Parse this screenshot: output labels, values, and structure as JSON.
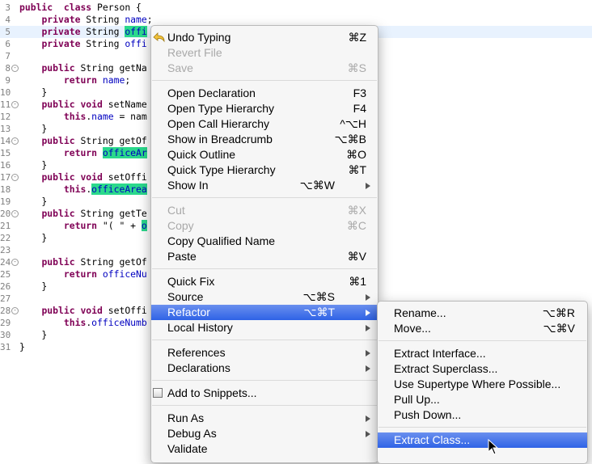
{
  "editor": {
    "lines": [
      {
        "num": "3",
        "fold": "",
        "parts": [
          [
            "kw",
            "public"
          ],
          [
            "",
            "  "
          ],
          [
            "kw",
            "class"
          ],
          [
            "",
            " Person {"
          ]
        ]
      },
      {
        "num": "4",
        "fold": "",
        "parts": [
          [
            "",
            "    "
          ],
          [
            "kw",
            "private"
          ],
          [
            "",
            " String "
          ],
          [
            "fld",
            "name"
          ],
          [
            "",
            ";"
          ]
        ]
      },
      {
        "num": "5",
        "fold": "",
        "current": true,
        "parts": [
          [
            "",
            "    "
          ],
          [
            "kw",
            "private"
          ],
          [
            "",
            " String "
          ],
          [
            "fld hl",
            "offi"
          ]
        ]
      },
      {
        "num": "6",
        "fold": "",
        "parts": [
          [
            "",
            "    "
          ],
          [
            "kw",
            "private"
          ],
          [
            "",
            " String "
          ],
          [
            "fld",
            "offi"
          ]
        ]
      },
      {
        "num": "7",
        "fold": "",
        "parts": []
      },
      {
        "num": "8",
        "fold": "-",
        "parts": [
          [
            "",
            "    "
          ],
          [
            "kw",
            "public"
          ],
          [
            "",
            " String getNa"
          ]
        ]
      },
      {
        "num": "9",
        "fold": "",
        "parts": [
          [
            "",
            "        "
          ],
          [
            "kw",
            "return"
          ],
          [
            "",
            " "
          ],
          [
            "fld",
            "name"
          ],
          [
            "",
            ";"
          ]
        ]
      },
      {
        "num": "10",
        "fold": "",
        "parts": [
          [
            "",
            "    }"
          ]
        ]
      },
      {
        "num": "11",
        "fold": "-",
        "parts": [
          [
            "",
            "    "
          ],
          [
            "kw",
            "public"
          ],
          [
            "",
            " "
          ],
          [
            "kw",
            "void"
          ],
          [
            "",
            " setName"
          ]
        ]
      },
      {
        "num": "12",
        "fold": "",
        "parts": [
          [
            "",
            "        "
          ],
          [
            "kw",
            "this"
          ],
          [
            "",
            "."
          ],
          [
            "fld",
            "name"
          ],
          [
            "",
            " = nam"
          ]
        ]
      },
      {
        "num": "13",
        "fold": "",
        "parts": [
          [
            "",
            "    }"
          ]
        ]
      },
      {
        "num": "14",
        "fold": "-",
        "parts": [
          [
            "",
            "    "
          ],
          [
            "kw",
            "public"
          ],
          [
            "",
            " String getOf"
          ]
        ]
      },
      {
        "num": "15",
        "fold": "",
        "parts": [
          [
            "",
            "        "
          ],
          [
            "kw",
            "return"
          ],
          [
            "",
            " "
          ],
          [
            "fld hl",
            "officeAr"
          ]
        ]
      },
      {
        "num": "16",
        "fold": "",
        "parts": [
          [
            "",
            "    }"
          ]
        ]
      },
      {
        "num": "17",
        "fold": "-",
        "parts": [
          [
            "",
            "    "
          ],
          [
            "kw",
            "public"
          ],
          [
            "",
            " "
          ],
          [
            "kw",
            "void"
          ],
          [
            "",
            " setOffi"
          ]
        ]
      },
      {
        "num": "18",
        "fold": "",
        "parts": [
          [
            "",
            "        "
          ],
          [
            "kw",
            "this"
          ],
          [
            "",
            "."
          ],
          [
            "fld hl",
            "officeArea"
          ]
        ]
      },
      {
        "num": "19",
        "fold": "",
        "parts": [
          [
            "",
            "    }"
          ]
        ]
      },
      {
        "num": "20",
        "fold": "-",
        "parts": [
          [
            "",
            "    "
          ],
          [
            "kw",
            "public"
          ],
          [
            "",
            " String getTe"
          ]
        ]
      },
      {
        "num": "21",
        "fold": "",
        "parts": [
          [
            "",
            "        "
          ],
          [
            "kw",
            "return"
          ],
          [
            "",
            " \"( \" + "
          ],
          [
            "fld hl",
            "o"
          ]
        ]
      },
      {
        "num": "22",
        "fold": "",
        "parts": [
          [
            "",
            "    }"
          ]
        ]
      },
      {
        "num": "23",
        "fold": "",
        "parts": []
      },
      {
        "num": "24",
        "fold": "-",
        "parts": [
          [
            "",
            "    "
          ],
          [
            "kw",
            "public"
          ],
          [
            "",
            " String getOf"
          ]
        ]
      },
      {
        "num": "25",
        "fold": "",
        "parts": [
          [
            "",
            "        "
          ],
          [
            "kw",
            "return"
          ],
          [
            "",
            " "
          ],
          [
            "fld",
            "officeNu"
          ]
        ]
      },
      {
        "num": "26",
        "fold": "",
        "parts": [
          [
            "",
            "    }"
          ]
        ]
      },
      {
        "num": "27",
        "fold": "",
        "parts": []
      },
      {
        "num": "28",
        "fold": "-",
        "parts": [
          [
            "",
            "    "
          ],
          [
            "kw",
            "public"
          ],
          [
            "",
            " "
          ],
          [
            "kw",
            "void"
          ],
          [
            "",
            " setOffi"
          ]
        ]
      },
      {
        "num": "29",
        "fold": "",
        "parts": [
          [
            "",
            "        "
          ],
          [
            "kw",
            "this"
          ],
          [
            "",
            "."
          ],
          [
            "fld",
            "officeNumb"
          ]
        ]
      },
      {
        "num": "30",
        "fold": "",
        "parts": [
          [
            "",
            "    }"
          ]
        ]
      },
      {
        "num": "31",
        "fold": "",
        "parts": [
          [
            "",
            "}"
          ]
        ]
      }
    ]
  },
  "context_menu": {
    "items": [
      {
        "label": "Undo Typing",
        "shortcut": "⌘Z",
        "icon": "undo-icon"
      },
      {
        "label": "Revert File",
        "shortcut": "",
        "disabled": true
      },
      {
        "label": "Save",
        "shortcut": "⌘S",
        "disabled": true
      },
      {
        "sep": true
      },
      {
        "label": "Open Declaration",
        "shortcut": "F3"
      },
      {
        "label": "Open Type Hierarchy",
        "shortcut": "F4"
      },
      {
        "label": "Open Call Hierarchy",
        "shortcut": "^⌥H"
      },
      {
        "label": "Show in Breadcrumb",
        "shortcut": "⌥⌘B"
      },
      {
        "label": "Quick Outline",
        "shortcut": "⌘O"
      },
      {
        "label": "Quick Type Hierarchy",
        "shortcut": "⌘T"
      },
      {
        "label": "Show In",
        "shortcut": "⌥⌘W",
        "submenu": true
      },
      {
        "sep": true
      },
      {
        "label": "Cut",
        "shortcut": "⌘X",
        "disabled": true
      },
      {
        "label": "Copy",
        "shortcut": "⌘C",
        "disabled": true
      },
      {
        "label": "Copy Qualified Name",
        "shortcut": ""
      },
      {
        "label": "Paste",
        "shortcut": "⌘V"
      },
      {
        "sep": true
      },
      {
        "label": "Quick Fix",
        "shortcut": "⌘1"
      },
      {
        "label": "Source",
        "shortcut": "⌥⌘S",
        "submenu": true
      },
      {
        "label": "Refactor",
        "shortcut": "⌥⌘T",
        "submenu": true,
        "active": true
      },
      {
        "label": "Local History",
        "shortcut": "",
        "submenu": true
      },
      {
        "sep": true
      },
      {
        "label": "References",
        "shortcut": "",
        "submenu": true
      },
      {
        "label": "Declarations",
        "shortcut": "",
        "submenu": true
      },
      {
        "sep": true
      },
      {
        "label": "Add to Snippets...",
        "shortcut": "",
        "icon": "snippet-icon"
      },
      {
        "sep": true
      },
      {
        "label": "Run As",
        "shortcut": "",
        "submenu": true
      },
      {
        "label": "Debug As",
        "shortcut": "",
        "submenu": true
      },
      {
        "label": "Validate",
        "shortcut": ""
      }
    ]
  },
  "refactor_menu": {
    "items": [
      {
        "label": "Rename...",
        "shortcut": "⌥⌘R"
      },
      {
        "label": "Move...",
        "shortcut": "⌥⌘V"
      },
      {
        "sep": true
      },
      {
        "label": "Extract Interface...",
        "shortcut": ""
      },
      {
        "label": "Extract Superclass...",
        "shortcut": ""
      },
      {
        "label": "Use Supertype Where Possible...",
        "shortcut": ""
      },
      {
        "label": "Pull Up...",
        "shortcut": ""
      },
      {
        "label": "Push Down...",
        "shortcut": ""
      },
      {
        "sep": true
      },
      {
        "label": "Extract Class...",
        "shortcut": "",
        "active": true
      }
    ]
  },
  "colors": {
    "keyword": "#7f0055",
    "field": "#0000c0",
    "occurrence_highlight": "#2bd98c",
    "current_line": "#e8f2fe",
    "menu_selection": "#2f63e6"
  }
}
